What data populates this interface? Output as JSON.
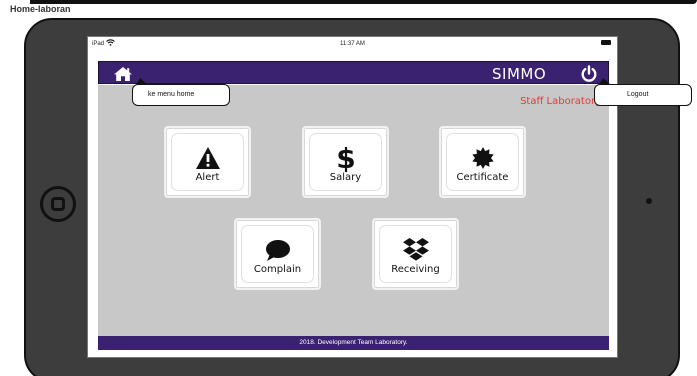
{
  "page": {
    "label": "Home-laboran"
  },
  "status_bar": {
    "device": "iPad",
    "wifi_icon": "wifi-icon",
    "time": "11:37 AM",
    "battery_icon": "battery-icon"
  },
  "header": {
    "home_icon": "home-icon",
    "title": "SIMMO",
    "power_icon": "power-icon",
    "brand_color": "#3b2270"
  },
  "role": {
    "label": "Staff Laboratory",
    "color": "#e53935"
  },
  "tiles": [
    {
      "label": "Alert",
      "icon": "alert-icon"
    },
    {
      "label": "Salary",
      "icon": "dollar-icon"
    },
    {
      "label": "Certificate",
      "icon": "certificate-icon"
    },
    {
      "label": "Complain",
      "icon": "comment-icon"
    },
    {
      "label": "Receiving",
      "icon": "dropbox-icon"
    }
  ],
  "footer": {
    "text": "2018. Development Team Laboratory."
  },
  "annotations": {
    "home": "ke menu home",
    "logout": "Logout"
  }
}
